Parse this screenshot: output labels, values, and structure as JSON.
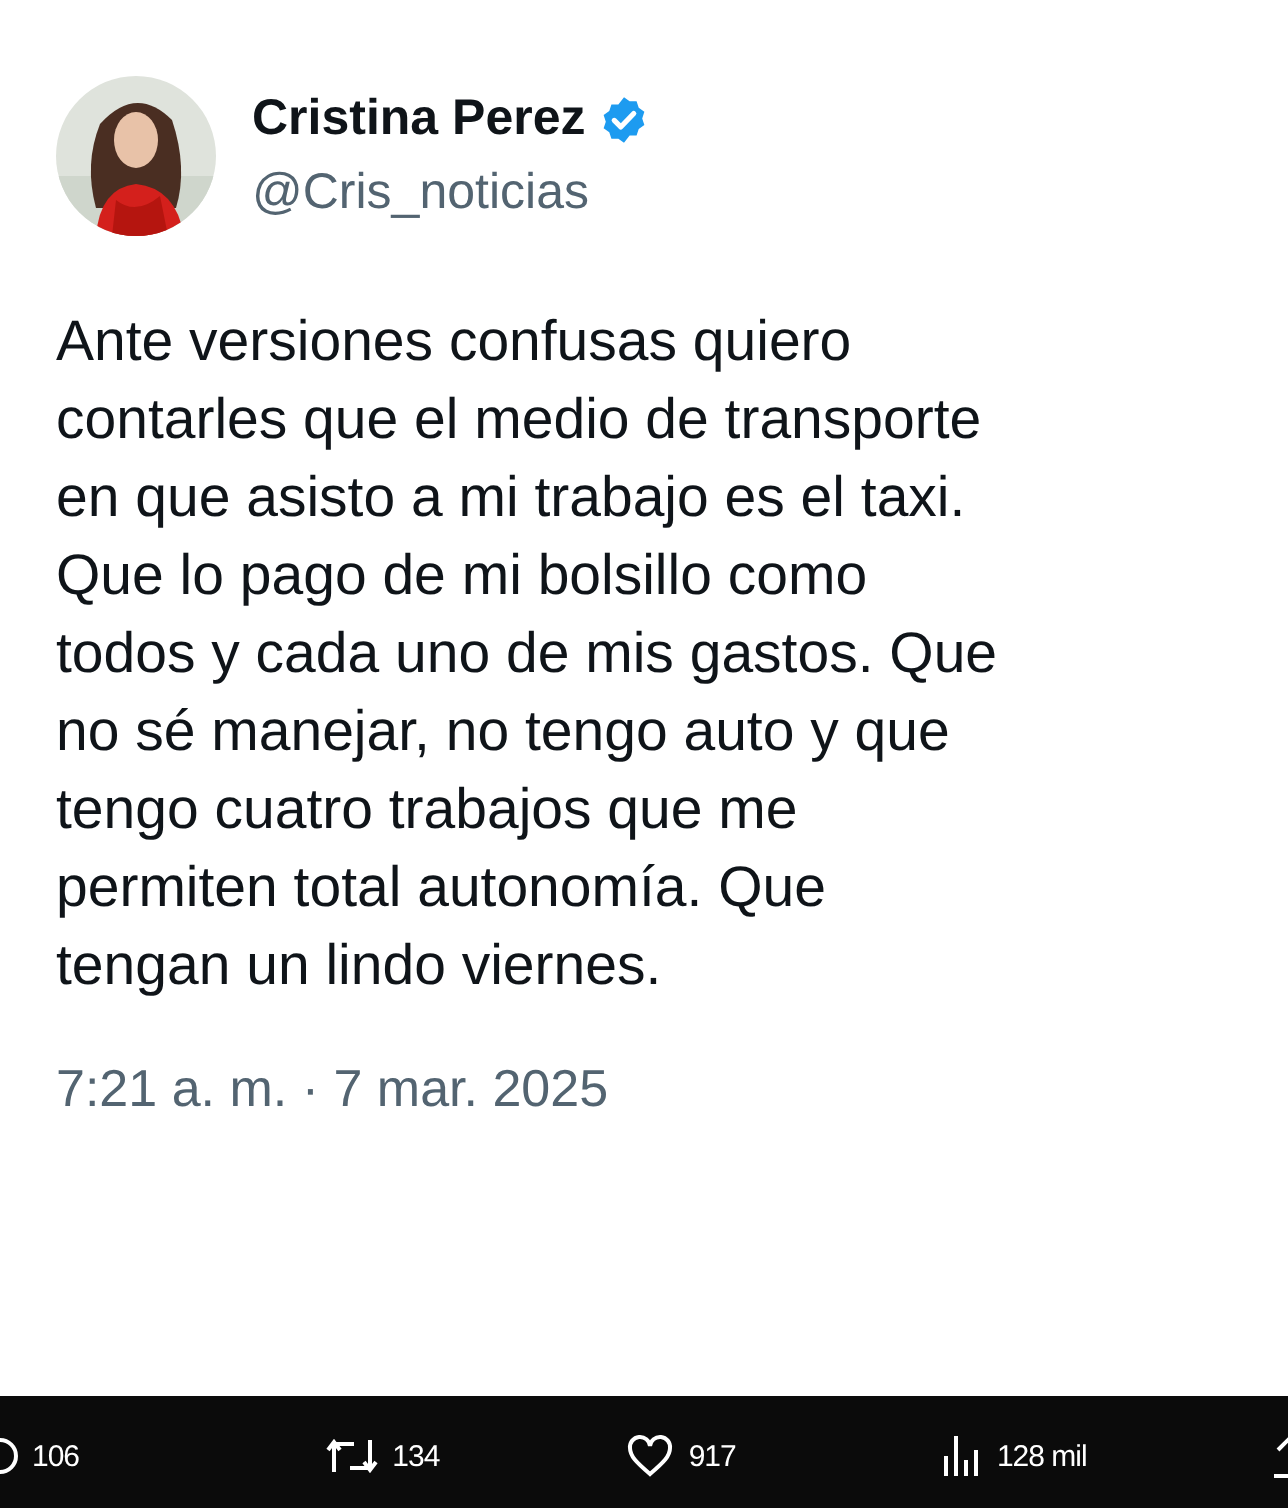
{
  "author": {
    "name": "Cristina Perez",
    "verified": true,
    "handle": "@Cris_noticias"
  },
  "text": "Ante versiones confusas quiero\ncontarles que el medio de transporte\nen que asisto a mi trabajo es el taxi.\nQue lo pago de mi bolsillo como\ntodos y cada uno de mis gastos. Que\nno sé manejar, no tengo auto y que\ntengo cuatro trabajos que me\npermiten total autonomía. Que\ntengan un lindo viernes.",
  "timestamp": "7:21 a. m. · 7 mar. 2025",
  "stats": [
    {
      "kind": "reply",
      "count": "106"
    },
    {
      "kind": "repost",
      "count": "134"
    },
    {
      "kind": "like",
      "count": "917"
    },
    {
      "kind": "views",
      "count": "128 mil"
    },
    {
      "kind": "share"
    }
  ]
}
